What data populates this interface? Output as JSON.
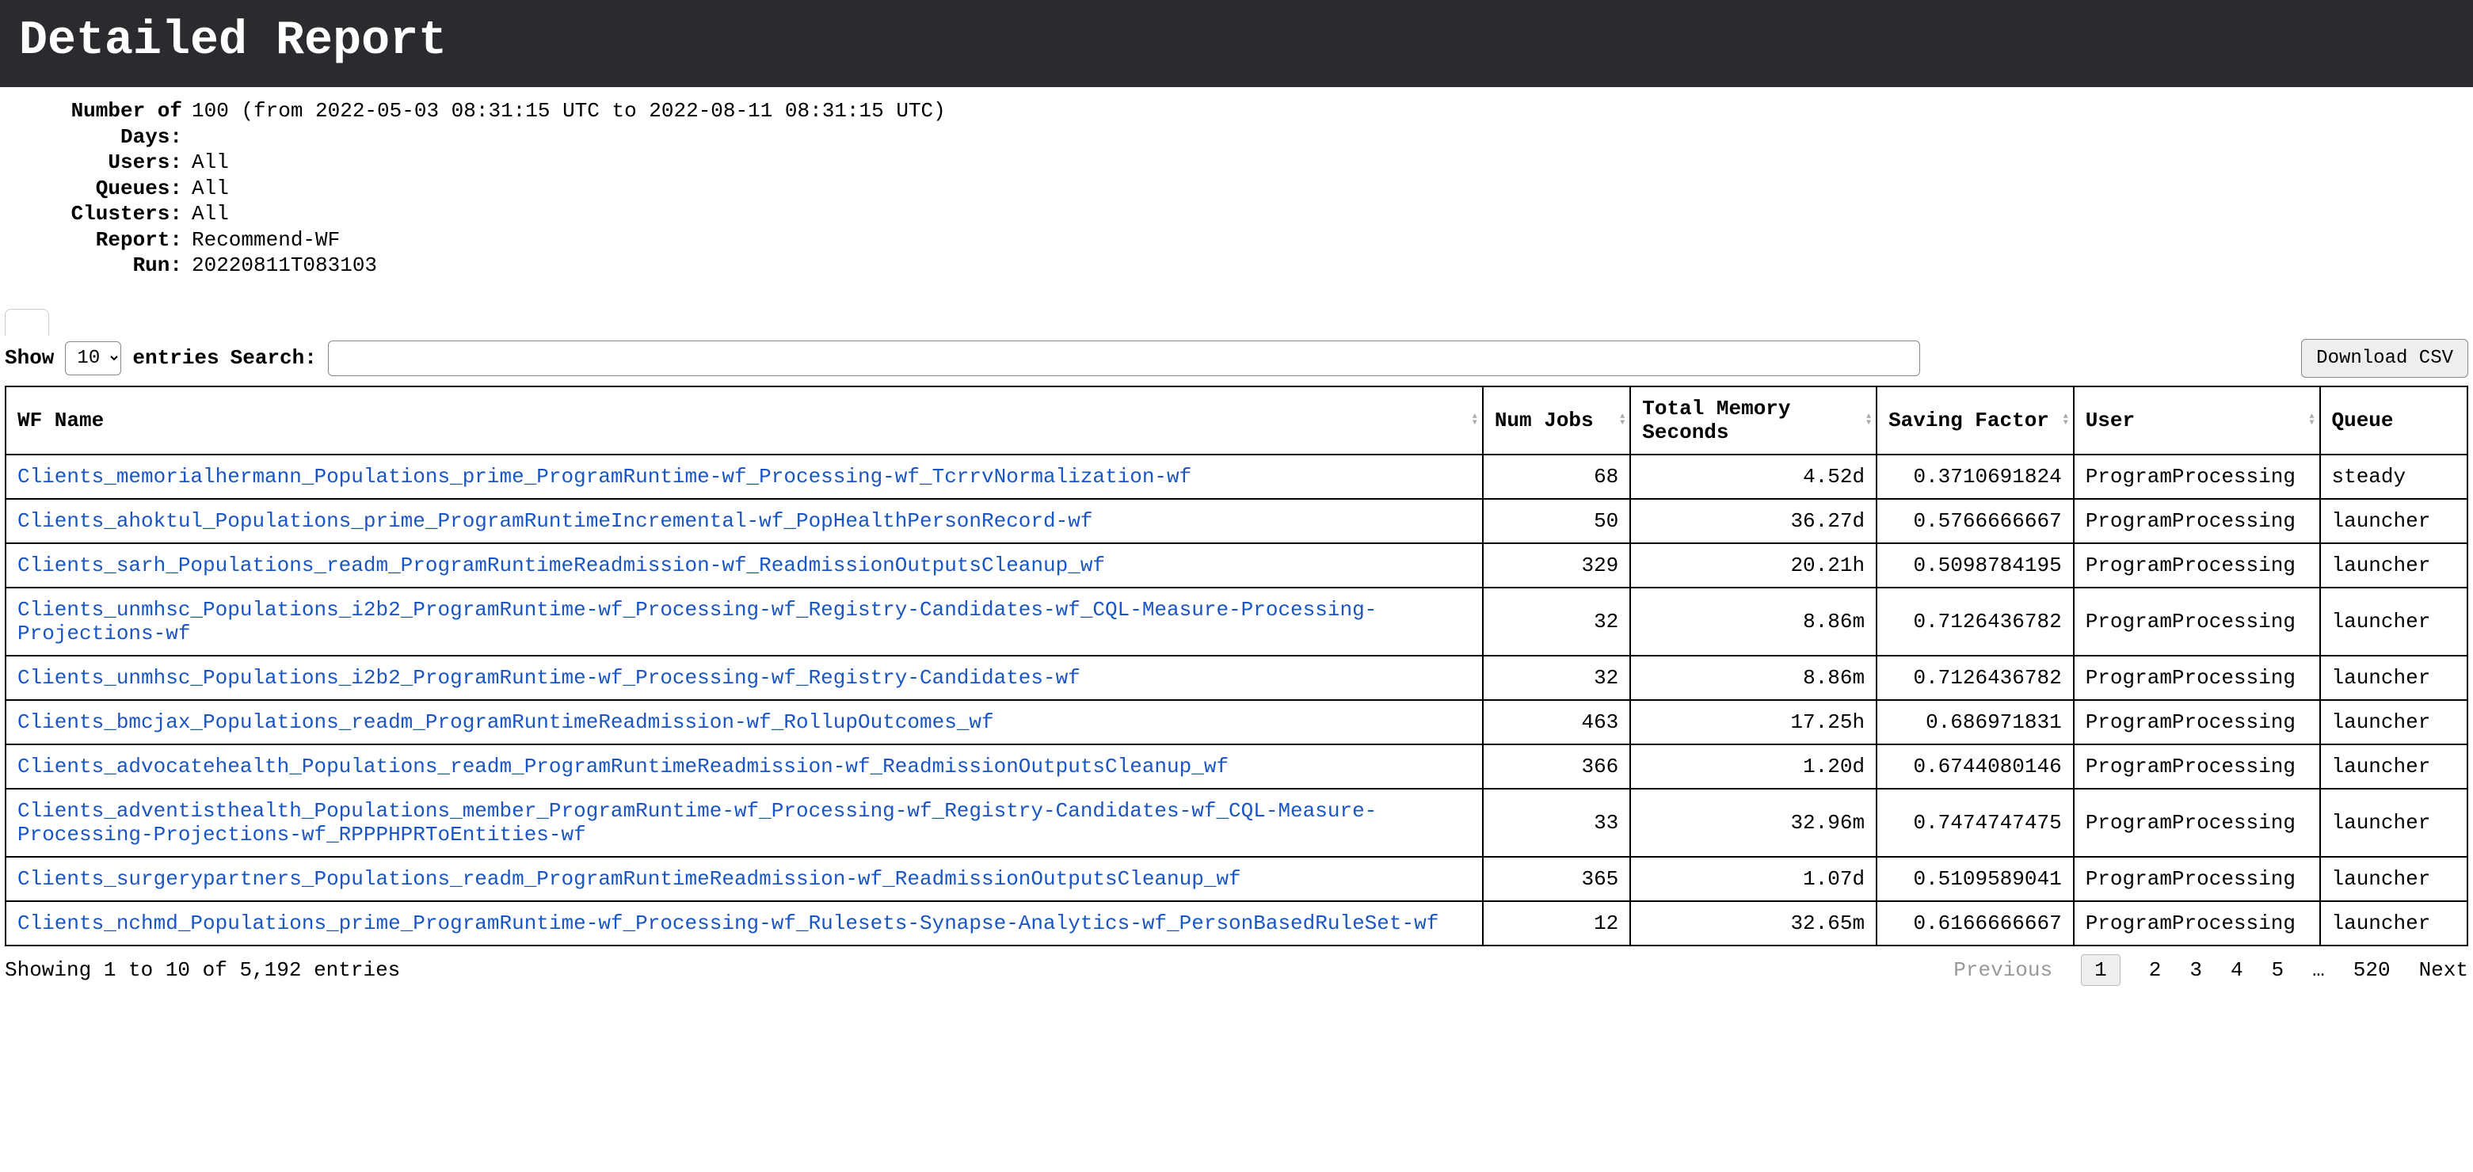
{
  "header": {
    "title": "Detailed Report"
  },
  "meta": {
    "days_label": "Number of Days:",
    "days_value": "100 (from 2022-05-03 08:31:15 UTC to 2022-08-11 08:31:15 UTC)",
    "users_label": "Users:",
    "users_value": "All",
    "queues_label": "Queues:",
    "queues_value": "All",
    "clusters_label": "Clusters:",
    "clusters_value": "All",
    "report_label": "Report:",
    "report_value": "Recommend-WF",
    "run_label": "Run:",
    "run_value": "20220811T083103"
  },
  "toolbar": {
    "show_label": "Show",
    "page_size": "10",
    "entries_label": "entries",
    "search_label": "Search:",
    "search_value": "",
    "download_label": "Download CSV"
  },
  "columns": {
    "wf_name": "WF Name",
    "num_jobs": "Num Jobs",
    "total_mem": "Total Memory Seconds",
    "saving": "Saving Factor",
    "user": "User",
    "queue": "Queue"
  },
  "rows": [
    {
      "wf": "Clients_memorialhermann_Populations_prime_ProgramRuntime-wf_Processing-wf_TcrrvNormalization-wf",
      "jobs": "68",
      "mem": "4.52d",
      "sav": "0.3710691824",
      "user": "ProgramProcessing",
      "queue": "steady"
    },
    {
      "wf": "Clients_ahoktul_Populations_prime_ProgramRuntimeIncremental-wf_PopHealthPersonRecord-wf",
      "jobs": "50",
      "mem": "36.27d",
      "sav": "0.5766666667",
      "user": "ProgramProcessing",
      "queue": "launcher"
    },
    {
      "wf": "Clients_sarh_Populations_readm_ProgramRuntimeReadmission-wf_ReadmissionOutputsCleanup_wf",
      "jobs": "329",
      "mem": "20.21h",
      "sav": "0.5098784195",
      "user": "ProgramProcessing",
      "queue": "launcher"
    },
    {
      "wf": "Clients_unmhsc_Populations_i2b2_ProgramRuntime-wf_Processing-wf_Registry-Candidates-wf_CQL-Measure-Processing-Projections-wf",
      "jobs": "32",
      "mem": "8.86m",
      "sav": "0.7126436782",
      "user": "ProgramProcessing",
      "queue": "launcher"
    },
    {
      "wf": "Clients_unmhsc_Populations_i2b2_ProgramRuntime-wf_Processing-wf_Registry-Candidates-wf",
      "jobs": "32",
      "mem": "8.86m",
      "sav": "0.7126436782",
      "user": "ProgramProcessing",
      "queue": "launcher"
    },
    {
      "wf": "Clients_bmcjax_Populations_readm_ProgramRuntimeReadmission-wf_RollupOutcomes_wf",
      "jobs": "463",
      "mem": "17.25h",
      "sav": "0.686971831",
      "user": "ProgramProcessing",
      "queue": "launcher"
    },
    {
      "wf": "Clients_advocatehealth_Populations_readm_ProgramRuntimeReadmission-wf_ReadmissionOutputsCleanup_wf",
      "jobs": "366",
      "mem": "1.20d",
      "sav": "0.6744080146",
      "user": "ProgramProcessing",
      "queue": "launcher"
    },
    {
      "wf": "Clients_adventisthealth_Populations_member_ProgramRuntime-wf_Processing-wf_Registry-Candidates-wf_CQL-Measure-Processing-Projections-wf_RPPPHPRToEntities-wf",
      "jobs": "33",
      "mem": "32.96m",
      "sav": "0.7474747475",
      "user": "ProgramProcessing",
      "queue": "launcher"
    },
    {
      "wf": "Clients_surgerypartners_Populations_readm_ProgramRuntimeReadmission-wf_ReadmissionOutputsCleanup_wf",
      "jobs": "365",
      "mem": "1.07d",
      "sav": "0.5109589041",
      "user": "ProgramProcessing",
      "queue": "launcher"
    },
    {
      "wf": "Clients_nchmd_Populations_prime_ProgramRuntime-wf_Processing-wf_Rulesets-Synapse-Analytics-wf_PersonBasedRuleSet-wf",
      "jobs": "12",
      "mem": "32.65m",
      "sav": "0.6166666667",
      "user": "ProgramProcessing",
      "queue": "launcher"
    }
  ],
  "footer": {
    "info": "Showing 1 to 10 of 5,192 entries",
    "previous": "Previous",
    "next": "Next",
    "pages": [
      "1",
      "2",
      "3",
      "4",
      "5",
      "…",
      "520"
    ],
    "current_page": "1"
  }
}
